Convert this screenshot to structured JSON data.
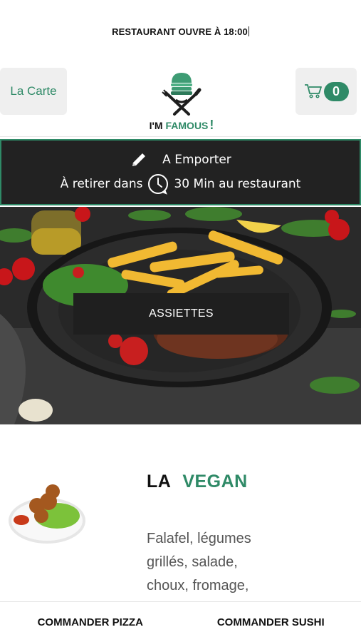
{
  "banner": {
    "text": "RESTAURANT OUVRE À 18:00"
  },
  "header": {
    "menu_label": "La Carte",
    "logo_text_1": "I'M",
    "logo_text_2": "FAMOUS",
    "logo_text_3": "!",
    "cart_count": "0",
    "cart_icon": "shopping-cart-icon",
    "accent_color": "#2f8a67"
  },
  "order": {
    "mode_label": "A Emporter",
    "pickup_prefix": "À retirer dans",
    "pickup_time": "30 Min au restaurant",
    "edit_icon": "pencil-icon",
    "clock_icon": "clock-icon"
  },
  "hero": {
    "category_label": "ASSIETTES"
  },
  "product": {
    "title_1": "LA",
    "title_2": "VEGAN",
    "description": "Falafel, légumes grillés, salade, choux, fromage,"
  },
  "bottom": {
    "pizza_label": "COMMANDER PIZZA",
    "sushi_label": "COMMANDER SUSHI"
  }
}
